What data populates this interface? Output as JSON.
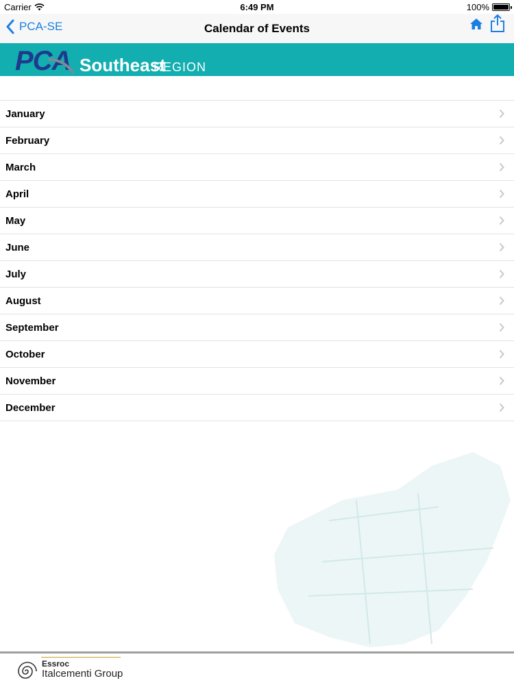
{
  "status_bar": {
    "carrier": "Carrier",
    "time": "6:49 PM",
    "battery": "100%"
  },
  "nav": {
    "back_label": "PCA-SE",
    "title": "Calendar of Events"
  },
  "banner": {
    "pca": "PCA",
    "region_name": "Southeast",
    "region_word": "REGION"
  },
  "months": [
    {
      "label": "January"
    },
    {
      "label": "February"
    },
    {
      "label": "March"
    },
    {
      "label": "April"
    },
    {
      "label": "May"
    },
    {
      "label": "June"
    },
    {
      "label": "July"
    },
    {
      "label": "August"
    },
    {
      "label": "September"
    },
    {
      "label": "October"
    },
    {
      "label": "November"
    },
    {
      "label": "December"
    }
  ],
  "footer": {
    "company": "Essroc",
    "group": "Italcementi Group"
  },
  "colors": {
    "accent": "#1a7fe3",
    "banner": "#12aeb0",
    "pca_blue": "#1f3a8c"
  }
}
